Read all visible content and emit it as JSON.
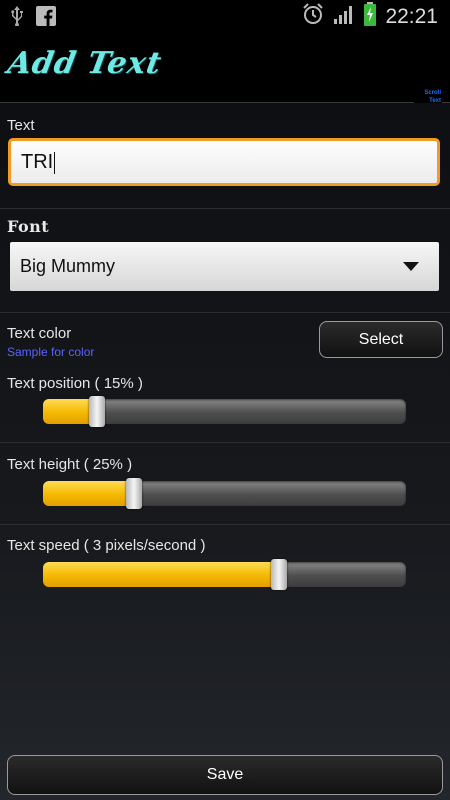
{
  "status_bar": {
    "time": "22:21",
    "icons": [
      "usb-icon",
      "facebook-icon",
      "alarm-icon",
      "signal-icon",
      "battery-charging-icon"
    ]
  },
  "header": {
    "logo_text": "Add Text",
    "app_logo": "Scroll Text Pro"
  },
  "form": {
    "text_label": "Text",
    "text_value": "TRI",
    "font_label": "Font",
    "font_value": "Big Mummy",
    "color_label": "Text color",
    "color_sample": "Sample for color",
    "select_button": "Select",
    "position_label": "Text position ( 15% )",
    "position_value": 0.15,
    "height_label": "Text height ( 25% )",
    "height_value": 0.25,
    "speed_label": "Text speed ( 3 pixels/second )",
    "speed_value": 0.65,
    "save_button": "Save"
  },
  "colors": {
    "accent": "#f19a26",
    "slider_fill": "#f5b800",
    "logo": "#6fe9e3",
    "color_sample": "#5a63ff"
  }
}
